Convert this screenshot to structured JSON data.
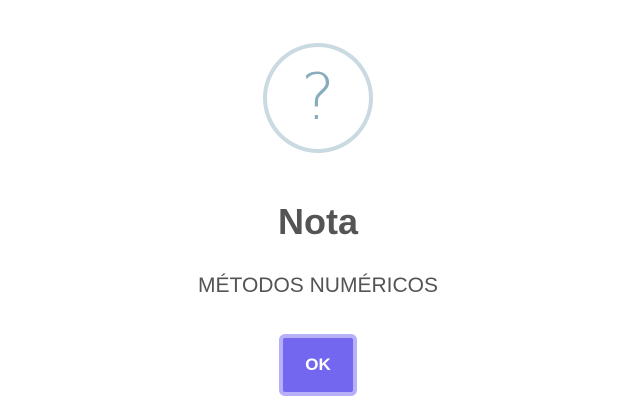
{
  "dialog": {
    "icon": {
      "name": "question-mark-icon",
      "glyph": "?",
      "ring_color": "#c9dae1",
      "glyph_color": "#87adbd"
    },
    "title": "Nota",
    "message": "MÉTODOS NUMÉRICOS",
    "confirm_button_label": "OK",
    "confirm_button_color": "#7367f0",
    "text_color": "#545454"
  }
}
